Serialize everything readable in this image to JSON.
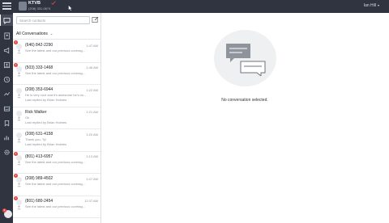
{
  "header": {
    "brand_name": "KTVB",
    "brand_phone": "(208) 331-0674",
    "user_name": "Ian Hill"
  },
  "rail": {
    "items": [
      {
        "icon": "chat-bubble-icon",
        "active": true
      },
      {
        "icon": "contacts-book-icon"
      },
      {
        "icon": "megaphone-icon"
      },
      {
        "icon": "person-icon"
      },
      {
        "icon": "clock-icon"
      },
      {
        "icon": "analytics-icon"
      },
      {
        "icon": "inbox-icon"
      },
      {
        "icon": "bookmark-icon"
      },
      {
        "icon": "chart-icon"
      },
      {
        "icon": "settings-icon"
      }
    ],
    "bottom_badge": "9"
  },
  "search": {
    "placeholder": "Search contacts"
  },
  "filter": {
    "label": "All Conversations"
  },
  "conversations": [
    {
      "name": "(646) 842-2290",
      "time": "1:47 AM",
      "preview": "See the latest and our previous coverag...",
      "sub": "",
      "badge": "1"
    },
    {
      "name": "(503) 333-1468",
      "time": "1:46 AM",
      "preview": "See the latest and our previous coverag...",
      "sub": "",
      "badge": "1"
    },
    {
      "name": "(208) 353-6944",
      "time": "1:22 AM",
      "preview": "He is very cool and it's awesome he's do...",
      "sub": "Last replied by Brian Holmes",
      "badge": ""
    },
    {
      "name": "Rick Walker",
      "time": "1:21 AM",
      "preview": "Ok",
      "sub": "Last replied by Brian Holmes",
      "badge": ""
    },
    {
      "name": "(208) 631-4158",
      "time": "1:20 AM",
      "preview": "Thank you, Ty!",
      "sub": "Last replied by Brian Holmes",
      "badge": ""
    },
    {
      "name": "(801) 413-6957",
      "time": "1:13 AM",
      "preview": "See the latest and our previous coverag...",
      "sub": "",
      "badge": "1"
    },
    {
      "name": "(208) 989-4502",
      "time": "1:07 AM",
      "preview": "See the latest and our previous coverag...",
      "sub": "",
      "badge": "1"
    },
    {
      "name": "(801) 680-2454",
      "time": "12:37 AM",
      "preview": "See the latest and our previous coverag...",
      "sub": "",
      "badge": "1"
    }
  ],
  "main": {
    "empty_message": "No conversation selected."
  },
  "colors": {
    "chrome_dark": "#2f3440",
    "badge_red": "#e04a3f",
    "empty_bubble": "#8f949c"
  }
}
